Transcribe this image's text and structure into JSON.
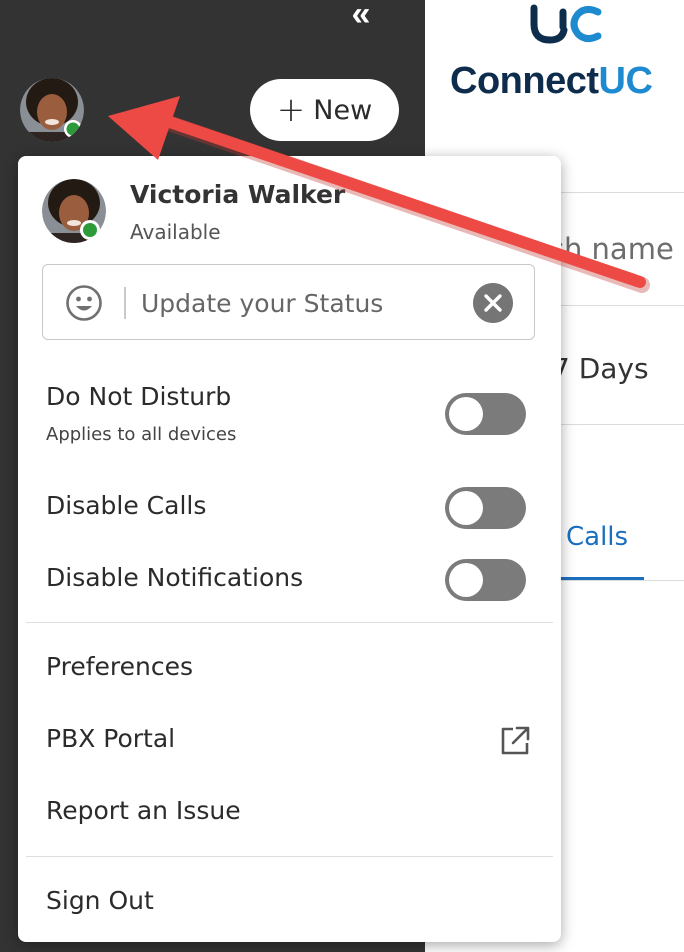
{
  "sidebar": {
    "collapse_glyph": "«",
    "new_button": {
      "icon": "plus-icon",
      "label": "New"
    },
    "avatar": {
      "presence": "available",
      "presence_color": "#2e9b3b"
    }
  },
  "background": {
    "logo": {
      "mark": "UC",
      "word_dark": "Connect",
      "word_accent": "UC"
    },
    "search_fragment": "ch name",
    "filter_fragment": "7 Days",
    "tab_fragment": "Calls",
    "accent_color": "#1a6fbf"
  },
  "menu": {
    "user": {
      "name": "Victoria Walker",
      "status": "Available"
    },
    "status_field": {
      "placeholder": "Update your Status",
      "value": ""
    },
    "toggles": [
      {
        "label": "Do Not Disturb",
        "sublabel": "Applies to all devices",
        "on": false
      },
      {
        "label": "Disable Calls",
        "on": false
      },
      {
        "label": "Disable Notifications",
        "on": false
      }
    ],
    "links": [
      {
        "label": "Preferences"
      },
      {
        "label": "PBX Portal",
        "icon": "external-link-icon"
      },
      {
        "label": "Report an Issue"
      }
    ],
    "sign_out": "Sign Out"
  },
  "annotation": {
    "color": "#ee4a45"
  }
}
